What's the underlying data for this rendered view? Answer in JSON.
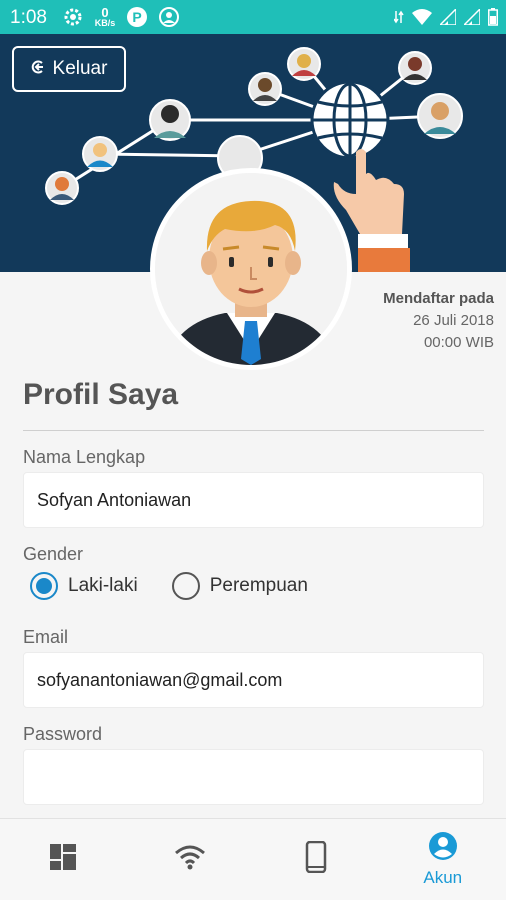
{
  "status_bar": {
    "time": "1:08",
    "network_speed_value": "0",
    "network_speed_unit": "KB/s",
    "icons": [
      "settings-gear-icon",
      "network-speed-icon",
      "parking-app-icon",
      "account-circle-icon",
      "data-arrows-icon",
      "wifi-icon",
      "signal-icon",
      "signal-icon-2",
      "battery-icon"
    ]
  },
  "header": {
    "logout_label": "Keluar",
    "logout_icon": "logout-icon"
  },
  "registration": {
    "label": "Mendaftar pada",
    "date": "26 Juli 2018",
    "time": "00:00 WIB"
  },
  "profile": {
    "title": "Profil Saya",
    "full_name_label": "Nama Lengkap",
    "full_name_value": "Sofyan Antoniawan",
    "gender_label": "Gender",
    "gender_options": [
      "Laki-laki",
      "Perempuan"
    ],
    "gender_selected": "Laki-laki",
    "email_label": "Email",
    "email_value": "sofyanantoniawan@gmail.com",
    "password_label": "Password",
    "password_value": ""
  },
  "bottom_nav": {
    "items": [
      {
        "icon": "dashboard-icon",
        "label": ""
      },
      {
        "icon": "wifi-icon",
        "label": ""
      },
      {
        "icon": "phone-icon",
        "label": ""
      },
      {
        "icon": "account-icon",
        "label": "Akun"
      }
    ],
    "active_color": "#1a9ad6",
    "inactive_color": "#555555"
  },
  "colors": {
    "status_bar": "#1fbfb8",
    "banner": "#12395a",
    "accent": "#1a88c9"
  }
}
